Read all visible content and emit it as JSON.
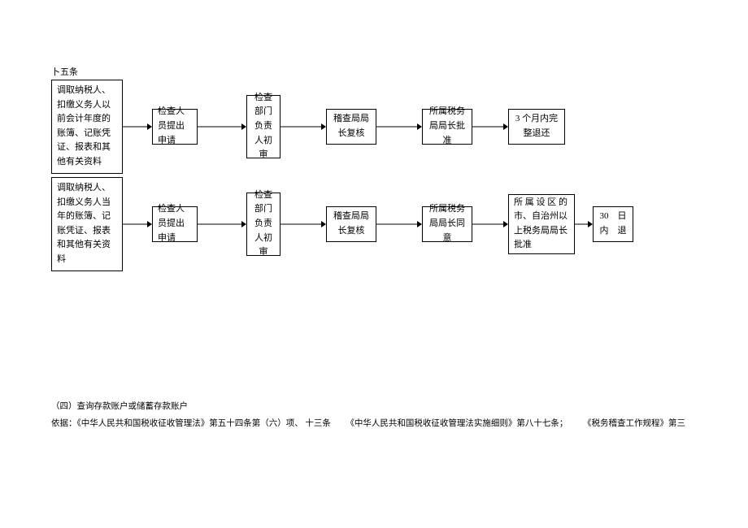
{
  "header": "卜五条",
  "flow1": {
    "b1": "调取纳税人、扣缴义务人以前会计年度的账簿、记账凭证、报表和其他有关资料",
    "b2": "检查人员提出申请",
    "b3": "检查部门负责人初审",
    "b4": "稽查局局长复核",
    "b5": "所属税务局局长批准",
    "b6": "3 个月内完整退还"
  },
  "flow2": {
    "b1": "调取纳税人、扣缴义务人当年的账簿、记账凭证、报表和其他有关资料",
    "b2": "检查人员提出申请",
    "b3": "检查部门负责人初审",
    "b4": "稽查局局长复核",
    "b5": "所属税务局局长同意",
    "b6": "所 属 设 区 的市、自治州以上税务局局长批准",
    "b7": "30　日内　退"
  },
  "footer": {
    "line1": "（四）查询存款账户或储蓄存款账户",
    "line2a": "依据：《中华人民共和国税收征收管理法》第五十四条第（六）项、 十三条",
    "line2b": "《中华人民共和国税收征收管理法实施细则》第八十七条；",
    "line2c": "《税务稽查工作规程》第三"
  }
}
